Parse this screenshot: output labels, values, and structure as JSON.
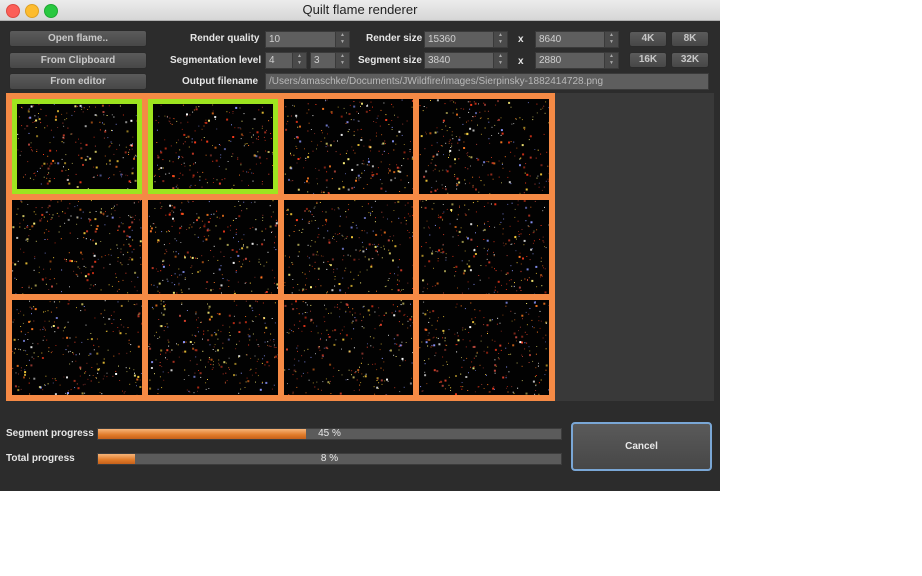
{
  "window": {
    "title": "Quilt flame renderer"
  },
  "buttons": {
    "open_flame": "Open flame..",
    "from_clipboard": "From Clipboard",
    "from_editor": "From editor",
    "b4k": "4K",
    "b8k": "8K",
    "b16k": "16K",
    "b32k": "32K",
    "cancel": "Cancel"
  },
  "settings": {
    "render_quality_label": "Render quality",
    "render_quality": "10",
    "segmentation_level_label": "Segmentation level",
    "segmentation_x": "4",
    "segmentation_y": "3",
    "render_size_label": "Render size",
    "render_width": "15360",
    "render_height": "8640",
    "segment_size_label": "Segment size",
    "segment_width": "3840",
    "segment_height": "2880",
    "x_separator": "x",
    "output_filename_label": "Output filename",
    "output_filename": "/Users/amaschke/Documents/JWildfire/images/Sierpinsky-1882414728.png"
  },
  "progress": {
    "segment_label": "Segment progress",
    "segment_value": 45,
    "segment_text": "45 %",
    "total_label": "Total progress",
    "total_value": 8,
    "total_text": "8 %"
  },
  "colors": {
    "segment_border": "#f58a45",
    "selected_segment_border": "#9ee41f"
  },
  "segments": {
    "columns": 4,
    "rows": 3,
    "completed": [
      0,
      1
    ]
  }
}
